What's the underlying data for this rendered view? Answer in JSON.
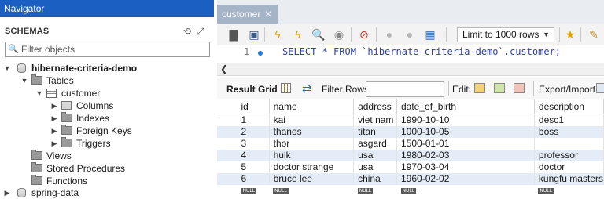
{
  "navigator": {
    "title": "Navigator",
    "schemas_label": "SCHEMAS",
    "filter_placeholder": "Filter objects",
    "tree": {
      "db1": "hibernate-criteria-demo",
      "tables": "Tables",
      "customer": "customer",
      "columns": "Columns",
      "indexes": "Indexes",
      "foreign_keys": "Foreign Keys",
      "triggers": "Triggers",
      "views": "Views",
      "stored_procedures": "Stored Procedures",
      "functions": "Functions",
      "db2": "spring-data"
    }
  },
  "editor_tab": {
    "label": "customer",
    "close": "✕"
  },
  "toolbar": {
    "limit_label": "Limit to 1000 rows"
  },
  "editor": {
    "line_number": "1",
    "sql": "SELECT * FROM `hibernate-criteria-demo`.customer;"
  },
  "result": {
    "grid_label": "Result Grid",
    "filter_rows_label": "Filter Rows:",
    "edit_label": "Edit:",
    "export_label": "Export/Import:",
    "columns": [
      "id",
      "name",
      "address",
      "date_of_birth",
      "description"
    ],
    "rows": [
      [
        "1",
        "kai",
        "viet nam",
        "1990-10-10",
        "desc1"
      ],
      [
        "2",
        "thanos",
        "titan",
        "1000-10-05",
        "boss"
      ],
      [
        "3",
        "thor",
        "asgard",
        "1500-01-01",
        ""
      ],
      [
        "4",
        "hulk",
        "usa",
        "1980-02-03",
        "professor"
      ],
      [
        "5",
        "doctor strange",
        "usa",
        "1970-03-04",
        "doctor"
      ],
      [
        "6",
        "bruce lee",
        "china",
        "1960-02-02",
        "kungfu masters"
      ]
    ],
    "null_label": "NULL"
  },
  "colors": {
    "nav_header": "#1c5fc2",
    "tab_active": "#a6b4c8",
    "row_stripe": "#e4ecf7",
    "sql_text": "#2f3fa8"
  }
}
